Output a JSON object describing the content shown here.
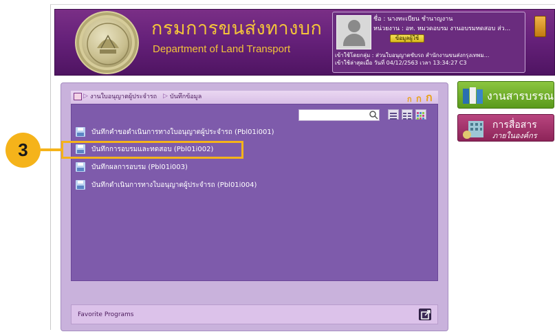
{
  "header": {
    "logo_thai": "กรมการขนส่งทางบก",
    "logo_en": "Department of Land Transport",
    "seal_text": "กรมการขนส่งทางบก"
  },
  "user": {
    "name_line": "ชื่อ :  นางทะเบียน ชำนาญงาน",
    "unit_line": "หน่วยงาน : อท. หมวดอบรม งานอบรมทดสอบ ส่ว...",
    "profile_button": "ข้อมูลผู้ใช้",
    "login_group": "เข้าใช้โดยกลุ่ม : ส่วนใบอนุญาตขับรถ สำนักงานขนส่งกรุงเทพม...",
    "last_login": "เข้าใช้ล่าสุดเมื่อ วันที่ 04/12/2563 เวลา 13:34:27 C3"
  },
  "breadcrumb": {
    "items": [
      "งานใบอนุญาตผู้ประจำรถ",
      "บันทึกข้อมูล"
    ]
  },
  "font_size_buttons": [
    "ก",
    "ก",
    "ก"
  ],
  "search": {
    "value": "",
    "placeholder": ""
  },
  "menu_items": [
    {
      "label": "บันทึกคำขอดำเนินการทางใบอนุญาตผู้ประจำรถ (Pbl01i001)"
    },
    {
      "label": "บันทึกการอบรมและทดสอบ (Pbl01i002)"
    },
    {
      "label": "บันทึกผลการอบรม (Pbl01i003)"
    },
    {
      "label": "บันทึกดำเนินการทางใบอนุญาตผู้ประจำรถ (Pbl01i004)"
    }
  ],
  "favorite": {
    "label": "Favorite Programs"
  },
  "side_buttons": {
    "saraban": "งานสารบรรณ",
    "comm_line1": "การสื่อสาร",
    "comm_line2": "ภายในองค์กร"
  },
  "callout": {
    "number": "3"
  },
  "colors": {
    "header_purple": "#66217a",
    "logo_gold": "#f3c33a",
    "content_purple": "#7e5bab",
    "callout_orange": "#f5b31a",
    "saraban_green": "#6fae2c",
    "comm_magenta": "#a3336b"
  }
}
